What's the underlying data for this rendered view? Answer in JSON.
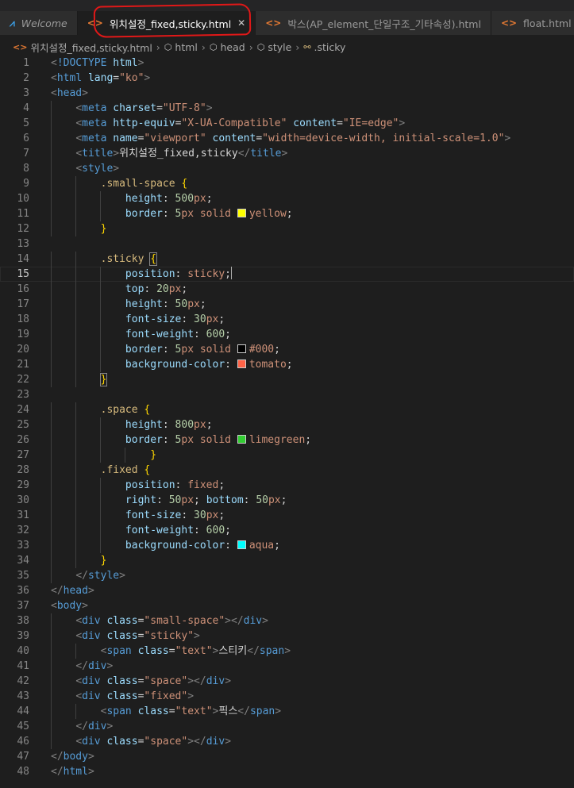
{
  "tabs": [
    {
      "label": "Welcome",
      "icon": "vscode-icon",
      "active": false,
      "italic": true
    },
    {
      "label": "위치설정_fixed,sticky.html",
      "icon": "html-file-icon",
      "active": true
    },
    {
      "label": "박스(AP_element_단일구조_기타속성).html",
      "icon": "html-file-icon",
      "active": false
    },
    {
      "label": "float.html",
      "icon": "html-file-icon",
      "active": false
    }
  ],
  "breadcrumb": [
    "위치설정_fixed,sticky.html",
    "html",
    "head",
    "style",
    ".sticky"
  ],
  "current_line": 15,
  "colors": {
    "yellow": "#ffff00",
    "black": "#000000",
    "tomato": "#ff6347",
    "limegreen": "#32cd32",
    "aqua": "#00ffff"
  },
  "code_lines": [
    "<!DOCTYPE html>",
    "<html lang=\"ko\">",
    "<head>",
    "    <meta charset=\"UTF-8\">",
    "    <meta http-equiv=\"X-UA-Compatible\" content=\"IE=edge\">",
    "    <meta name=\"viewport\" content=\"width=device-width, initial-scale=1.0\">",
    "    <title>위치설정_fixed,sticky</title>",
    "    <style>",
    "        .small-space {",
    "            height: 500px;",
    "            border: 5px solid yellow;",
    "        }",
    "",
    "        .sticky {",
    "            position: sticky;",
    "            top: 20px;",
    "            height: 50px;",
    "            font-size: 30px;",
    "            font-weight: 600;",
    "            border: 5px solid #000;",
    "            background-color: tomato;",
    "        }",
    "",
    "        .space {",
    "            height: 800px;",
    "            border: 5px solid limegreen;",
    "                }",
    "        .fixed {",
    "            position: fixed;",
    "            right: 50px; bottom: 50px;",
    "            font-size: 30px;",
    "            font-weight: 600;",
    "            background-color: aqua;",
    "        }",
    "    </style>",
    "</head>",
    "<body>",
    "    <div class=\"small-space\"></div>",
    "    <div class=\"sticky\">",
    "        <span class=\"text\">스티키</span>",
    "    </div>",
    "    <div class=\"space\"></div>",
    "    <div class=\"fixed\">",
    "        <span class=\"text\">픽스</span>",
    "    </div>",
    "    <div class=\"space\"></div>",
    "</body>",
    "</html>"
  ]
}
